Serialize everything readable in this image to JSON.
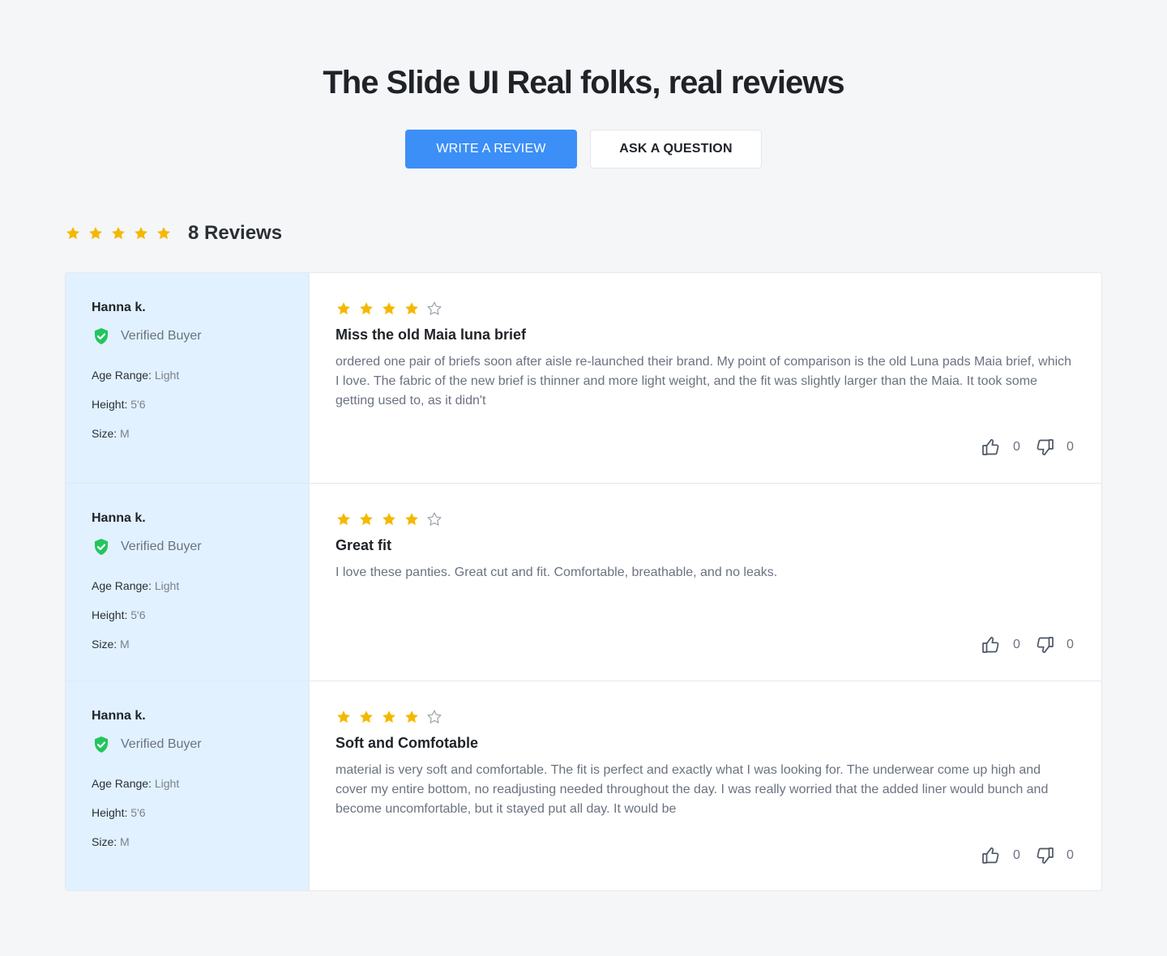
{
  "header": {
    "title": "The Slide UI Real folks, real reviews",
    "write_button": "WRITE A REVIEW",
    "ask_button": "ASK A QUESTION"
  },
  "summary": {
    "rating": 5,
    "count_label": "8 Reviews"
  },
  "colors": {
    "accent": "#3b8ff7",
    "star": "#f5b800",
    "verified": "#22c55e",
    "reviewer_bg": "#e1f1ff"
  },
  "reviews": [
    {
      "name": "Hanna k.",
      "verified_label": "Verified Buyer",
      "age_label": "Age Range:",
      "age_value": "Light",
      "height_label": "Height:",
      "height_value": "5'6",
      "size_label": "Size:",
      "size_value": "M",
      "rating": 4,
      "title": "Miss the old Maia luna brief",
      "text": "ordered one pair of briefs soon after aisle re-launched their brand. My point of comparison is the old Luna pads Maia brief, which I love. The fabric of the new brief is thinner and more light weight, and the fit was slightly larger than the Maia. It took some getting used to, as it didn't",
      "likes": "0",
      "dislikes": "0"
    },
    {
      "name": "Hanna k.",
      "verified_label": "Verified Buyer",
      "age_label": "Age Range:",
      "age_value": "Light",
      "height_label": "Height:",
      "height_value": "5'6",
      "size_label": "Size:",
      "size_value": "M",
      "rating": 4,
      "title": "Great fit",
      "text": "I love these panties. Great cut and fit. Comfortable, breathable, and no leaks.",
      "likes": "0",
      "dislikes": "0"
    },
    {
      "name": "Hanna k.",
      "verified_label": "Verified Buyer",
      "age_label": "Age Range:",
      "age_value": "Light",
      "height_label": "Height:",
      "height_value": "5'6",
      "size_label": "Size:",
      "size_value": "M",
      "rating": 4,
      "title": "Soft and Comfotable",
      "text": "material is very soft and comfortable. The fit is perfect and exactly what I was looking for. The underwear come up high and cover my entire bottom, no readjusting needed throughout the day. I was really worried that the added liner would bunch and become uncomfortable, but it stayed put all day. It would be",
      "likes": "0",
      "dislikes": "0"
    }
  ]
}
